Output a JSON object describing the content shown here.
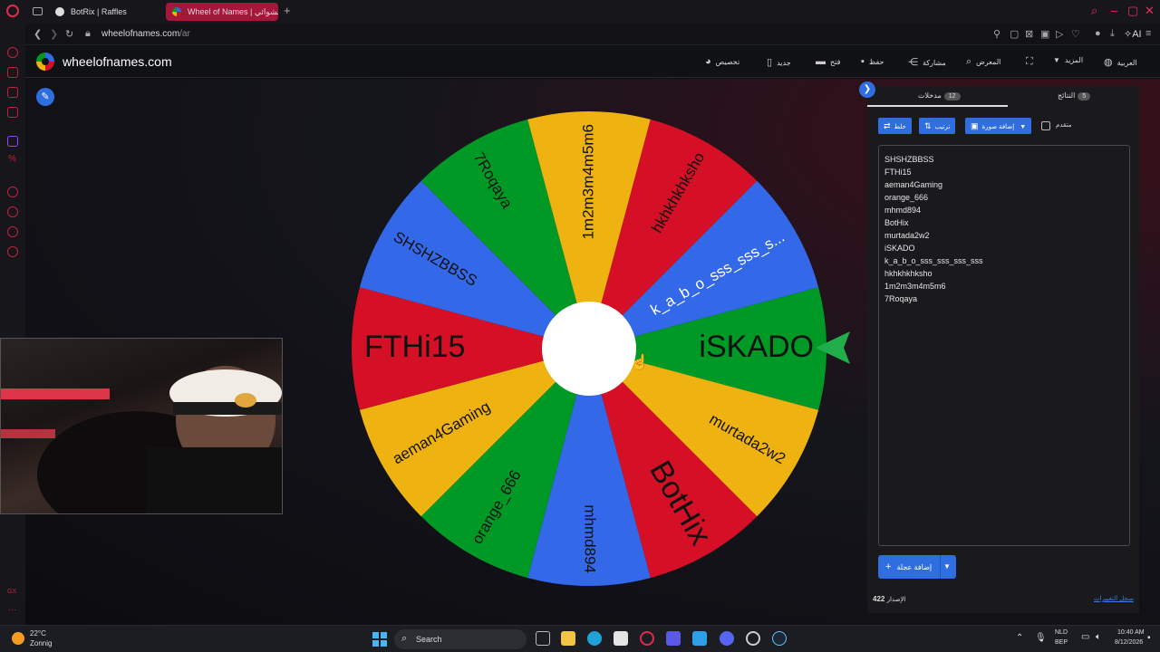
{
  "browser": {
    "tabs": [
      {
        "label": "BotRix | Raffles"
      },
      {
        "label": "Wheel of Names | العشوائي"
      }
    ],
    "url_host": "wheelofnames.com",
    "url_path": "/ar",
    "ai_label": "AI"
  },
  "site": {
    "name": "wheelofnames.com",
    "menu": {
      "customize": "تخصيص",
      "new": "جديد",
      "open": "فتح",
      "save": "حفظ",
      "share": "مشاركة",
      "gallery": "المعرض",
      "more": "المزيد",
      "language": "العربية"
    }
  },
  "wheel": {
    "segments": [
      {
        "label": "iSKADO",
        "color": "#009925"
      },
      {
        "label": "murtada2w2",
        "color": "#eeb211"
      },
      {
        "label": "BotHix",
        "color": "#d50f25"
      },
      {
        "label": "mhmd894",
        "color": "#3369e8"
      },
      {
        "label": "orange_666",
        "color": "#009925"
      },
      {
        "label": "aeman4Gaming",
        "color": "#eeb211"
      },
      {
        "label": "FTHi15",
        "color": "#d50f25"
      },
      {
        "label": "SHSHZBBSS",
        "color": "#3369e8"
      },
      {
        "label": "7Roqaya",
        "color": "#009925"
      },
      {
        "label": "1m2m3m4m5m6",
        "color": "#eeb211"
      },
      {
        "label": "hkhkhkhksho",
        "color": "#d50f25"
      },
      {
        "label": "k_a_b_o_sss_sss_s...",
        "color": "#3369e8"
      }
    ],
    "pointer_color": "#1fae4b"
  },
  "panel": {
    "tab_entries": {
      "label": "مدخلات",
      "count": "12"
    },
    "tab_results": {
      "label": "النتائج",
      "count": "5"
    },
    "buttons": {
      "shuffle": "خلط",
      "sort": "ترتيب",
      "add_image": "إضافة صورة",
      "advanced": "متقدم"
    },
    "entries": [
      "SHSHZBBSS",
      "FTHi15",
      "aeman4Gaming",
      "orange_666",
      "mhmd894",
      "BotHix",
      "murtada2w2",
      "iSKADO",
      "k_a_b_o_sss_sss_sss_sss",
      "hkhkhkhksho",
      "1m2m3m4m5m6",
      "7Roqaya"
    ],
    "add_wheel": "إضافة عجلة",
    "version_label": "الإصدار",
    "version_number": "422",
    "changelog": "سجل التغييرات"
  },
  "taskbar": {
    "temperature": "22°C",
    "weather": "Zonnig",
    "search": "Search",
    "lang1": "NLD",
    "lang2": "BEP",
    "time": "10:40 AM",
    "date": "8/12/2026"
  }
}
